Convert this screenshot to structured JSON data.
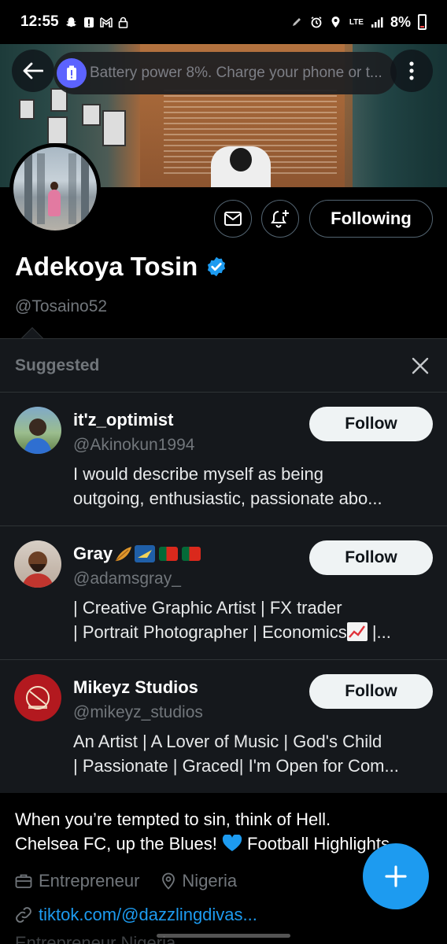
{
  "status_bar": {
    "time": "12:55",
    "network": "LTE",
    "battery_pct": "8%"
  },
  "header": {
    "toast_text": "Battery power 8%. Charge your phone or t..."
  },
  "profile": {
    "name": "Adekoya Tosin",
    "handle": "@Tosaino52",
    "following_label": "Following"
  },
  "suggested": {
    "title": "Suggested",
    "follow_label": "Follow",
    "items": [
      {
        "name": "it'z_optimist",
        "handle": "@Akinokun1994",
        "bio_line1": "I would describe myself as being",
        "bio_line2": "outgoing,  enthusiastic, passionate abo..."
      },
      {
        "name": "Gray",
        "handle": "@adamsgray_",
        "bio_line1": "| Creative Graphic Artist | FX trader",
        "bio_line2": "| Portrait Photographer | Economics",
        "bio_line2_tail": " |..."
      },
      {
        "name": "Mikeyz Studios",
        "handle": "@mikeyz_studios",
        "bio_line1": "An Artist | A Lover of Music | God's Child",
        "bio_line2": "| Passionate | Graced| I'm Open for Com..."
      }
    ]
  },
  "bio": {
    "line1": "When you’re tempted to sin, think of Hell.",
    "line2": "Chelsea FC, up the Blues! ",
    "line2_tail": " Football Highlights",
    "occupation": "Entrepreneur",
    "location": "Nigeria",
    "link": "tiktok.com/@dazzlingdivas...",
    "ghost_row": "Entrepreneur   Nigeria"
  },
  "colors": {
    "accent": "#1d9bf0",
    "toast_icon": "#5c63ff"
  }
}
